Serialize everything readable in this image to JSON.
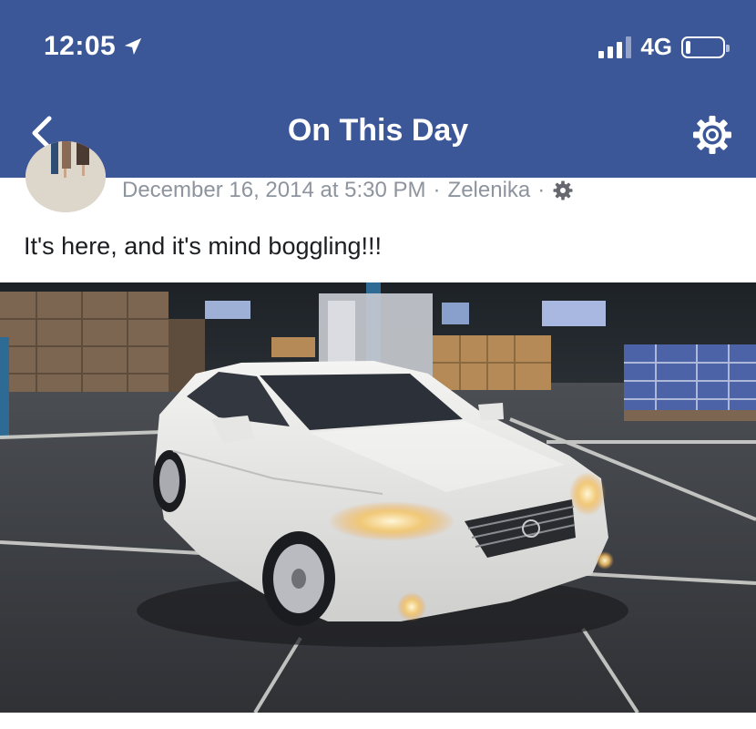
{
  "status_bar": {
    "time": "12:05",
    "network": "4G",
    "battery_level": 0.12
  },
  "nav": {
    "title": "On This Day",
    "back_icon": "chevron-left-icon",
    "settings_icon": "gear-icon"
  },
  "post": {
    "date": "December 16, 2014 at 5:30 PM",
    "separator": "·",
    "location": "Zelenika",
    "privacy_icon": "gear-icon",
    "text": "It's here, and it's mind boggling!!!"
  },
  "colors": {
    "header_bg": "#3b5797",
    "meta_text": "#8d949e",
    "body_text": "#1c1e21"
  }
}
